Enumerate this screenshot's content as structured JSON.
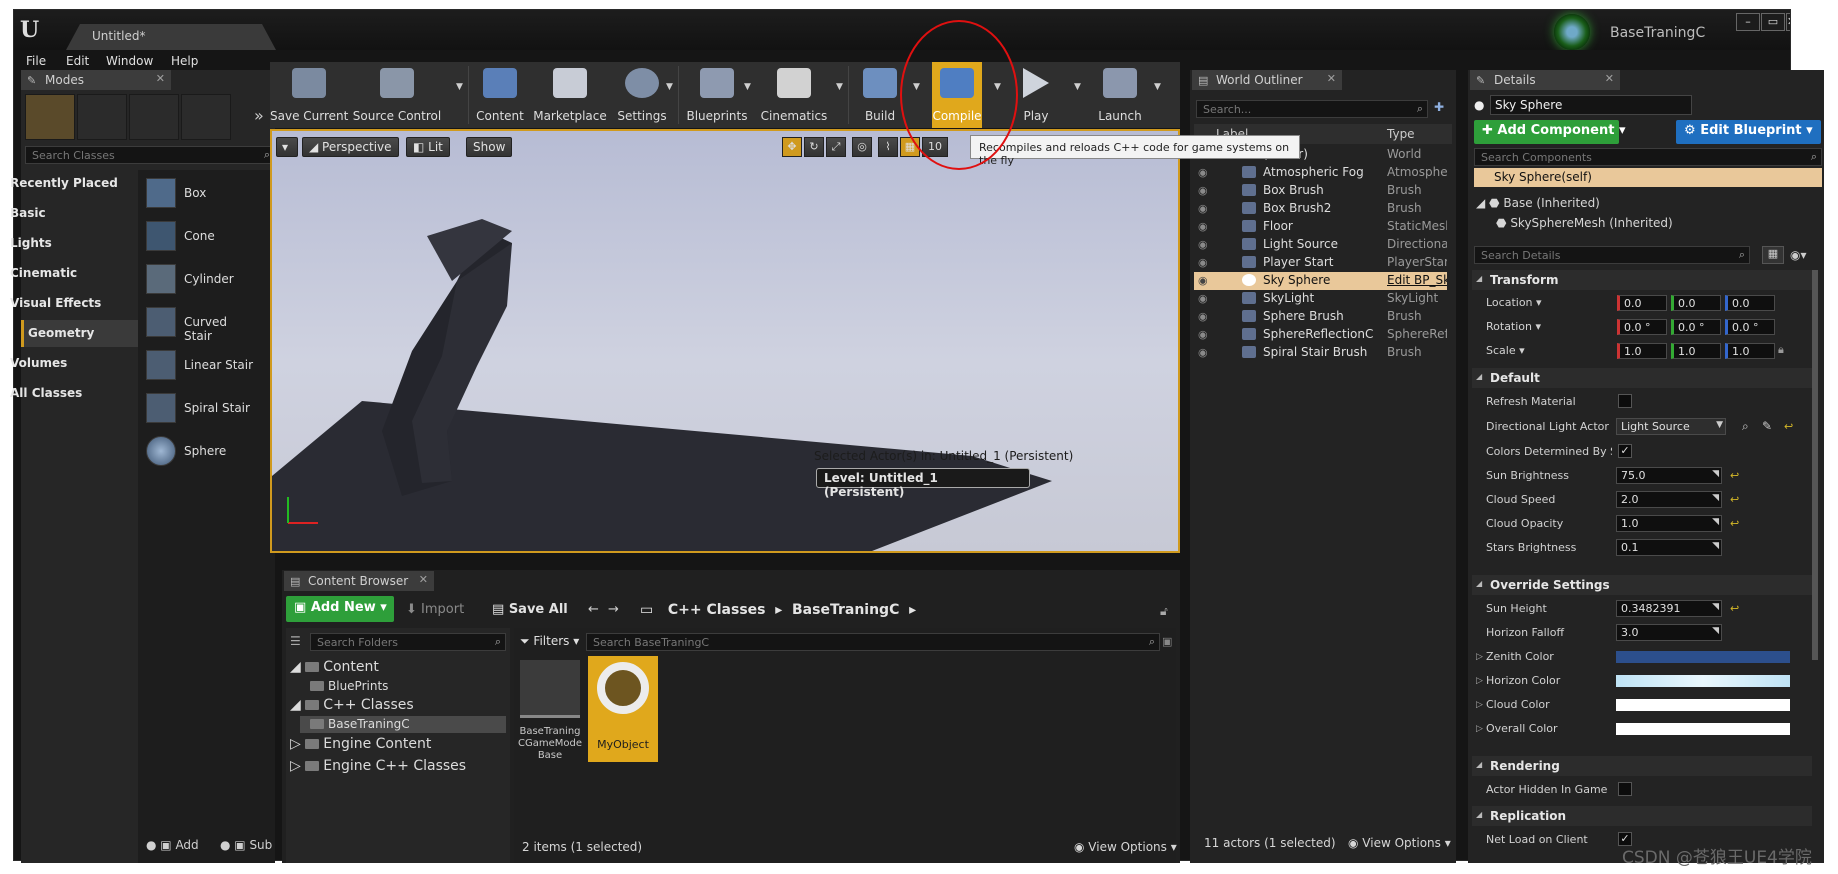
{
  "window": {
    "doc_tab": "Untitled*",
    "project_name": "BaseTraningC"
  },
  "menu": [
    "File",
    "Edit",
    "Window",
    "Help"
  ],
  "modes": {
    "tab": "Modes",
    "search_placeholder": "Search Classes",
    "categories": [
      "Recently Placed",
      "Basic",
      "Lights",
      "Cinematic",
      "Visual Effects",
      "Geometry",
      "Volumes",
      "All Classes"
    ],
    "active_category": "Geometry",
    "items": [
      "Box",
      "Cone",
      "Cylinder",
      "Curved Stair",
      "Linear Stair",
      "Spiral Stair",
      "Sphere"
    ],
    "footer": [
      "Add",
      "Sub"
    ]
  },
  "toolbar": {
    "buttons": [
      "Save Current",
      "Source Control",
      "Content",
      "Marketplace",
      "Settings",
      "Blueprints",
      "Cinematics",
      "Build",
      "Compile",
      "Play",
      "Launch"
    ],
    "tooltip": "Recompiles and reloads C++ code for game systems on the fly"
  },
  "viewport": {
    "perspective": "Perspective",
    "lit": "Lit",
    "show": "Show",
    "grid_snap": "10",
    "selected_info": "Selected Actor(s) in:  Untitled_1 (Persistent)",
    "level": "Level:  Untitled_1 (Persistent)"
  },
  "content_browser": {
    "tab": "Content Browser",
    "add_new": "Add New",
    "import": "Import",
    "save_all": "Save All",
    "path": [
      "C++ Classes",
      "BaseTraningC"
    ],
    "folder_search": "Search Folders",
    "filters": "Filters",
    "asset_search": "Search BaseTraningC",
    "tree": [
      "Content",
      "BluePrints",
      "C++ Classes",
      "BaseTraningC",
      "Engine Content",
      "Engine C++ Classes"
    ],
    "assets": [
      "BaseTraning CGameMode Base",
      "MyObject"
    ],
    "status": "2 items (1 selected)",
    "view_options": "View Options"
  },
  "outliner": {
    "tab": "World Outliner",
    "search_placeholder": "Search...",
    "col_label": "Label",
    "col_type": "Type",
    "rows": [
      {
        "label": "(Editor)",
        "type": "World"
      },
      {
        "label": "Atmospheric Fog",
        "type": "Atmospheric"
      },
      {
        "label": "Box Brush",
        "type": "Brush"
      },
      {
        "label": "Box Brush2",
        "type": "Brush"
      },
      {
        "label": "Floor",
        "type": "StaticMeshA"
      },
      {
        "label": "Light Source",
        "type": "DirectionalLi"
      },
      {
        "label": "Player Start",
        "type": "PlayerStart"
      },
      {
        "label": "Sky Sphere",
        "type": "Edit BP_Sky"
      },
      {
        "label": "SkyLight",
        "type": "SkyLight"
      },
      {
        "label": "Sphere Brush",
        "type": "Brush"
      },
      {
        "label": "SphereReflectionCaptu",
        "type": "SphereReflec"
      },
      {
        "label": "Spiral Stair Brush",
        "type": "Brush"
      }
    ],
    "status": "11 actors (1 selected)",
    "view_options": "View Options"
  },
  "details": {
    "tab": "Details",
    "name": "Sky Sphere",
    "add_component": "Add Component",
    "edit_blueprint": "Edit Blueprint",
    "search_components": "Search Components",
    "self": "Sky Sphere(self)",
    "inherited": "Base (Inherited)",
    "mesh": "SkySphereMesh (Inherited)",
    "search_details": "Search Details",
    "transform": {
      "title": "Transform",
      "location_label": "Location",
      "location": [
        "0.0",
        "0.0",
        "0.0"
      ],
      "rotation_label": "Rotation",
      "rotation": [
        "0.0 °",
        "0.0 °",
        "0.0 °"
      ],
      "scale_label": "Scale",
      "scale": [
        "1.0",
        "1.0",
        "1.0"
      ]
    },
    "default": {
      "title": "Default",
      "refresh_material": "Refresh Material",
      "dir_light_actor": "Directional Light Actor",
      "dir_light_value": "Light Source",
      "colors_determined": "Colors Determined By Sun",
      "sun_brightness": "Sun Brightness",
      "sun_brightness_value": "75.0",
      "cloud_speed": "Cloud Speed",
      "cloud_speed_value": "2.0",
      "cloud_opacity": "Cloud Opacity",
      "cloud_opacity_value": "1.0",
      "stars_brightness": "Stars Brightness",
      "stars_brightness_value": "0.1"
    },
    "override": {
      "title": "Override Settings",
      "sun_height": "Sun Height",
      "sun_height_value": "0.3482391",
      "horizon_falloff": "Horizon Falloff",
      "horizon_falloff_value": "3.0",
      "zenith_color": "Zenith Color",
      "horizon_color": "Horizon Color",
      "cloud_color": "Cloud Color",
      "overall_color": "Overall Color"
    },
    "rendering": {
      "title": "Rendering",
      "hidden": "Actor Hidden In Game"
    },
    "replication": {
      "title": "Replication",
      "net_load": "Net Load on Client"
    }
  },
  "watermark": "CSDN @苍狼王UE4学院",
  "colors": {
    "accent_orange": "#d09a1e",
    "green_button": "#2e9f3a",
    "blue_button": "#1f6fc0",
    "zenith": "#2c4f8c",
    "horizon": "#bfe3f5",
    "cloud": "#ffffff",
    "overall": "#ffffff"
  }
}
